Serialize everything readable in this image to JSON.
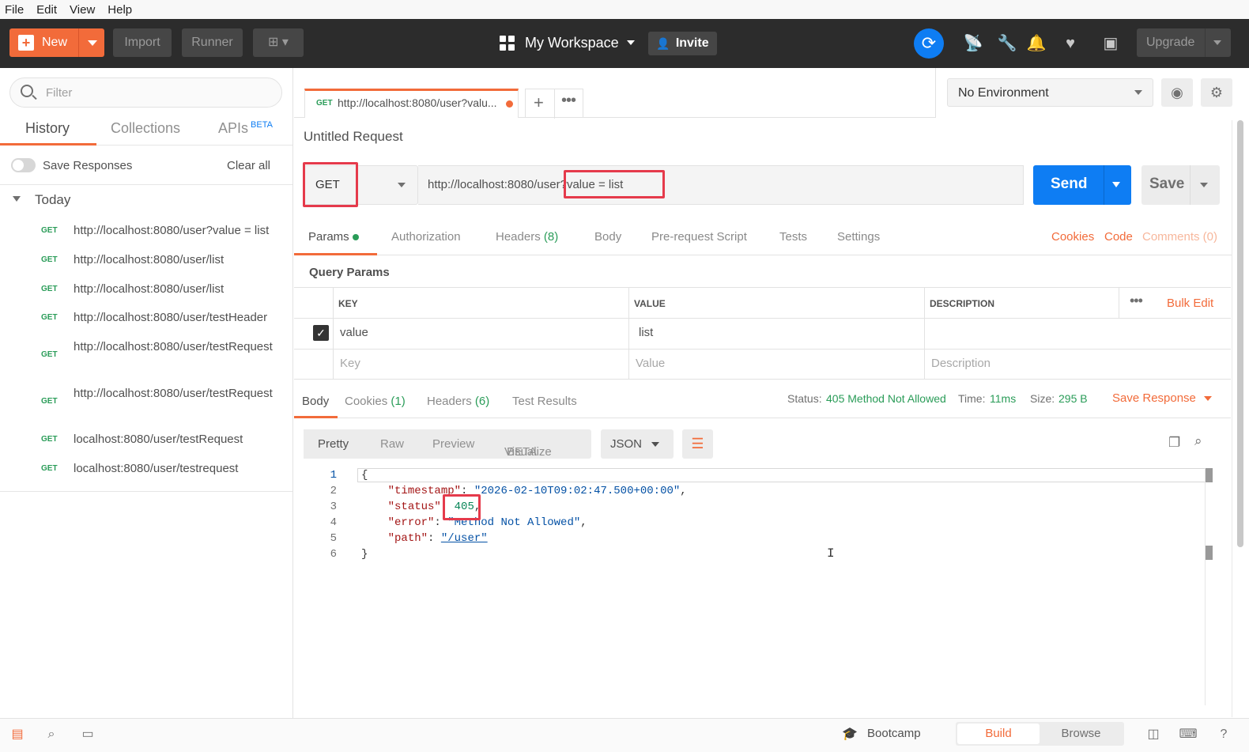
{
  "menu": [
    "File",
    "Edit",
    "View",
    "Help"
  ],
  "header": {
    "new_label": "New",
    "import_label": "Import",
    "runner_label": "Runner",
    "workspace": "My Workspace",
    "invite": "Invite",
    "upgrade": "Upgrade"
  },
  "sidebar": {
    "filter_placeholder": "Filter",
    "tabs": {
      "history": "History",
      "collections": "Collections",
      "apis": "APIs",
      "apis_badge": "BETA"
    },
    "save_responses": "Save Responses",
    "clear_all": "Clear all",
    "group": "Today",
    "items": [
      {
        "method": "GET",
        "url": "http://localhost:8080/user?value = list"
      },
      {
        "method": "GET",
        "url": "http://localhost:8080/user/list"
      },
      {
        "method": "GET",
        "url": "http://localhost:8080/user/list"
      },
      {
        "method": "GET",
        "url": "http://localhost:8080/user/testHeader"
      },
      {
        "method": "GET",
        "url": "http://localhost:8080/user/testRequest"
      },
      {
        "method": "GET",
        "url": "http://localhost:8080/user/testRequest"
      },
      {
        "method": "GET",
        "url": "localhost:8080/user/testRequest"
      },
      {
        "method": "GET",
        "url": "localhost:8080/user/testrequest"
      }
    ]
  },
  "request_tab": {
    "method": "GET",
    "url": "http://localhost:8080/user?valu..."
  },
  "environment": "No Environment",
  "request": {
    "title": "Untitled Request",
    "method": "GET",
    "url_base": "http://localhost:8080/use",
    "url_query": "r?value = list",
    "send": "Send",
    "save": "Save"
  },
  "req_tabs": {
    "params": "Params",
    "authorization": "Authorization",
    "headers": "Headers",
    "headers_count": "(8)",
    "body": "Body",
    "prerequest": "Pre-request Script",
    "tests": "Tests",
    "settings": "Settings",
    "cookies": "Cookies",
    "code": "Code",
    "comments": "Comments (0)"
  },
  "query_params": {
    "title": "Query Params",
    "columns": [
      "KEY",
      "VALUE",
      "DESCRIPTION"
    ],
    "bulk_edit": "Bulk Edit",
    "rows": [
      {
        "key": "value",
        "value": "list",
        "description": ""
      }
    ],
    "placeholders": {
      "key": "Key",
      "value": "Value",
      "description": "Description"
    }
  },
  "response_tabs": {
    "body": "Body",
    "cookies": "Cookies",
    "cookies_count": "(1)",
    "headers": "Headers",
    "headers_count": "(6)",
    "tests": "Test Results"
  },
  "response_status": {
    "status_label": "Status:",
    "status_value": "405 Method Not Allowed",
    "time_label": "Time:",
    "time_value": "11ms",
    "size_label": "Size:",
    "size_value": "295 B",
    "save_response": "Save Response"
  },
  "viewer": {
    "pretty": "Pretty",
    "raw": "Raw",
    "preview": "Preview",
    "visualize": "Visualize",
    "visualize_badge": "BETA",
    "format": "JSON"
  },
  "code_lines": [
    {
      "n": "1",
      "text": "{"
    },
    {
      "n": "2",
      "key": "\"timestamp\"",
      "val": "\"2026-02-10T09:02:47.500+00:00\"",
      "tail": ","
    },
    {
      "n": "3",
      "key": "\"status\"",
      "num": "405",
      "tail": ","
    },
    {
      "n": "4",
      "key": "\"error\"",
      "val": "\"Method Not Allowed\"",
      "tail": ","
    },
    {
      "n": "5",
      "key": "\"path\"",
      "val": "\"/user\"",
      "tail": ""
    },
    {
      "n": "6",
      "text": "}"
    }
  ],
  "footer": {
    "bootcamp": "Bootcamp",
    "build": "Build",
    "browse": "Browse"
  },
  "colors": {
    "accent": "#f26b3a",
    "send": "#0e7df3",
    "success": "#2a9c58",
    "highlight": "#e53a4b"
  }
}
